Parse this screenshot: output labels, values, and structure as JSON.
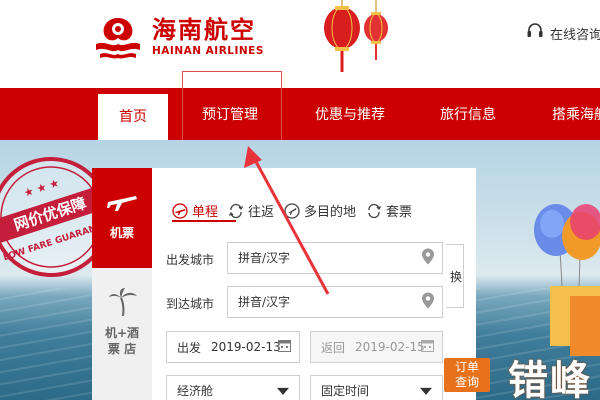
{
  "brand": {
    "name_cn": "海南航空",
    "name_en": "HAINAN AIRLINES",
    "color": "#cc0000"
  },
  "header": {
    "hotline_label": "在线咨询",
    "hotline_icon": "headset-icon"
  },
  "nav": {
    "items": [
      {
        "label": "首页",
        "active": true
      },
      {
        "label": "预订管理",
        "active": false
      },
      {
        "label": "优惠与推荐",
        "active": false
      },
      {
        "label": "旅行信息",
        "active": false
      },
      {
        "label": "搭乘海航",
        "active": false
      }
    ]
  },
  "promo_stamp": {
    "text_cn": "网价优保障",
    "text_en": "LOW FARE GUARANTEE"
  },
  "booking": {
    "side_tabs": [
      {
        "label": "机票",
        "icon": "plane-icon",
        "active": true
      },
      {
        "label_line1": "机+酒",
        "label_line2": "票 店",
        "icon": "palm-tree-icon",
        "active": false
      }
    ],
    "trip_types": [
      {
        "label": "单程",
        "icon": "plane-icon",
        "active": true
      },
      {
        "label": "往返",
        "icon": "round-trip-icon",
        "active": false
      },
      {
        "label": "多目的地",
        "icon": "multi-city-icon",
        "active": false
      },
      {
        "label": "套票",
        "icon": "package-icon",
        "active": false
      }
    ],
    "from": {
      "label": "出发城市",
      "placeholder": "拼音/汉字"
    },
    "to": {
      "label": "到达城市",
      "placeholder": "拼音/汉字"
    },
    "swap_label": "换",
    "depart": {
      "label": "出发",
      "value": "2019-02-13"
    },
    "return": {
      "label": "返回",
      "value": "2019-02-15"
    },
    "cabin": {
      "value": "经济舱"
    },
    "time": {
      "value": "固定时间"
    },
    "order_query_line1": "订单",
    "order_query_line2": "查询"
  },
  "banner_text": "错峰"
}
